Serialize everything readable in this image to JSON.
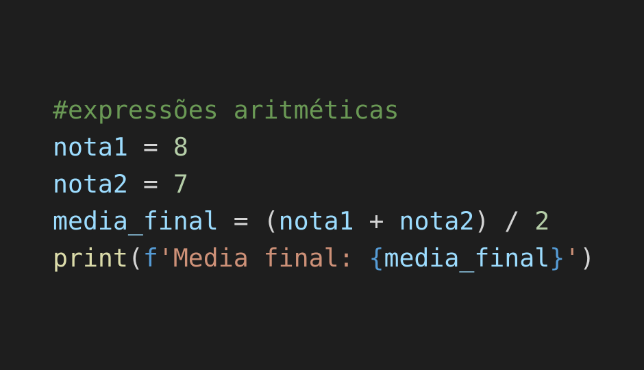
{
  "code": {
    "comment": "#expressões aritméticas",
    "line2": {
      "var": "nota1",
      "op": " = ",
      "num": "8"
    },
    "line3": {
      "var": "nota2",
      "op": " = ",
      "num": "7"
    },
    "line4": {
      "var": "media_final",
      "op_eq": " = ",
      "paren_open": "(",
      "var_a": "nota1",
      "op_plus": " + ",
      "var_b": "nota2",
      "paren_close": ")",
      "op_div": " / ",
      "num": "2"
    },
    "line5": {
      "func": "print",
      "paren_open": "(",
      "prefix": "f",
      "str_start": "'Media final: ",
      "brace_open": "{",
      "var": "media_final",
      "brace_close": "}",
      "str_end": "'",
      "paren_close": ")"
    }
  },
  "theme": {
    "background": "#1e1e1e",
    "comment": "#6a9955",
    "variable": "#9cdcfe",
    "number": "#b5cea8",
    "function": "#dcdcaa",
    "keyword": "#569cd6",
    "string": "#ce9178",
    "operator": "#d4d4d4"
  }
}
